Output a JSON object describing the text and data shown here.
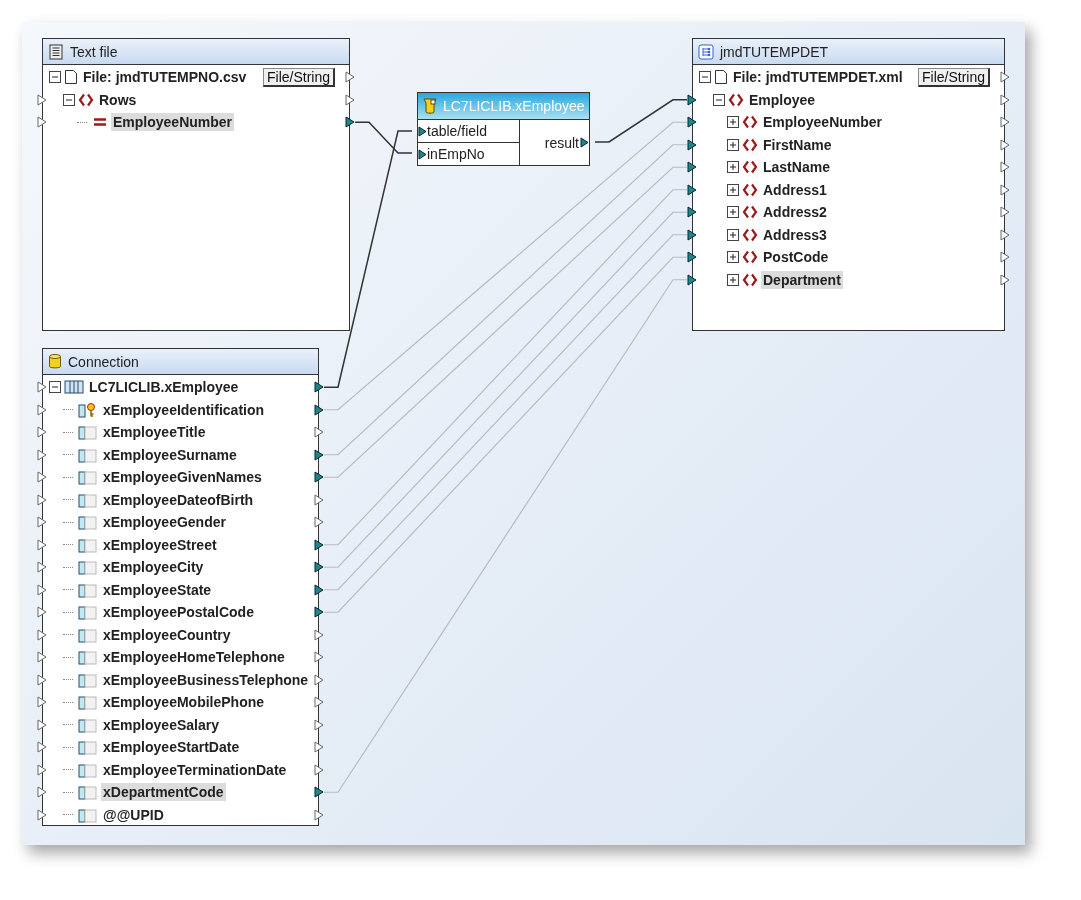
{
  "text_file": {
    "title": "Text file",
    "tree": [
      {
        "kind": "file",
        "label": "File: jmdTUTEMPNO.csv",
        "button": "File/String",
        "expanded": true,
        "selected": false,
        "out_connected": false,
        "children": [
          {
            "kind": "element",
            "label": "Rows",
            "expanded": true,
            "selected": false,
            "in_connected": false,
            "out_connected": false,
            "children": [
              {
                "kind": "field",
                "label": "EmployeeNumber",
                "selected": true,
                "in_connected": false,
                "out_connected": true
              }
            ]
          }
        ]
      }
    ]
  },
  "function": {
    "title": "LC7LICLIB.xEmployee",
    "inputs": [
      {
        "label": "table/field",
        "connected": true
      },
      {
        "label": "inEmpNo",
        "connected": true
      }
    ],
    "output": {
      "label": "result",
      "connected": true
    }
  },
  "target": {
    "title": "jmdTUTEMPDET",
    "tree": [
      {
        "kind": "file",
        "label": "File: jmdTUTEMPDET.xml",
        "button": "File/String",
        "expanded": true,
        "selected": false,
        "out_connected": false,
        "children": [
          {
            "kind": "element",
            "label": "Employee",
            "expanded": true,
            "selected": false,
            "in_connected": true,
            "out_connected": false,
            "children": [
              {
                "kind": "element",
                "label": "EmployeeNumber",
                "expanded": false,
                "selected": false,
                "in_connected": true,
                "out_connected": false
              },
              {
                "kind": "element",
                "label": "FirstName",
                "expanded": false,
                "selected": false,
                "in_connected": true,
                "out_connected": false
              },
              {
                "kind": "element",
                "label": "LastName",
                "expanded": false,
                "selected": false,
                "in_connected": true,
                "out_connected": false
              },
              {
                "kind": "element",
                "label": "Address1",
                "expanded": false,
                "selected": false,
                "in_connected": true,
                "out_connected": false
              },
              {
                "kind": "element",
                "label": "Address2",
                "expanded": false,
                "selected": false,
                "in_connected": true,
                "out_connected": false
              },
              {
                "kind": "element",
                "label": "Address3",
                "expanded": false,
                "selected": false,
                "in_connected": true,
                "out_connected": false
              },
              {
                "kind": "element",
                "label": "PostCode",
                "expanded": false,
                "selected": false,
                "in_connected": true,
                "out_connected": false
              },
              {
                "kind": "element",
                "label": "Department",
                "expanded": false,
                "selected": true,
                "in_connected": true,
                "out_connected": false
              }
            ]
          }
        ]
      }
    ]
  },
  "connection": {
    "title": "Connection",
    "tree": [
      {
        "kind": "table",
        "label": "LC7LICLIB.xEmployee",
        "expanded": true,
        "selected": false,
        "in_connected": false,
        "out_connected": true,
        "children": [
          {
            "kind": "key_column",
            "label": "xEmployeeIdentification",
            "selected": false,
            "in_connected": false,
            "out_connected": true
          },
          {
            "kind": "column",
            "label": "xEmployeeTitle",
            "selected": false,
            "in_connected": false,
            "out_connected": false
          },
          {
            "kind": "column",
            "label": "xEmployeeSurname",
            "selected": false,
            "in_connected": false,
            "out_connected": true
          },
          {
            "kind": "column",
            "label": "xEmployeeGivenNames",
            "selected": false,
            "in_connected": false,
            "out_connected": true
          },
          {
            "kind": "column",
            "label": "xEmployeeDateofBirth",
            "selected": false,
            "in_connected": false,
            "out_connected": false
          },
          {
            "kind": "column",
            "label": "xEmployeeGender",
            "selected": false,
            "in_connected": false,
            "out_connected": false
          },
          {
            "kind": "column",
            "label": "xEmployeeStreet",
            "selected": false,
            "in_connected": false,
            "out_connected": true
          },
          {
            "kind": "column",
            "label": "xEmployeeCity",
            "selected": false,
            "in_connected": false,
            "out_connected": true
          },
          {
            "kind": "column",
            "label": "xEmployeeState",
            "selected": false,
            "in_connected": false,
            "out_connected": true
          },
          {
            "kind": "column",
            "label": "xEmployeePostalCode",
            "selected": false,
            "in_connected": false,
            "out_connected": true
          },
          {
            "kind": "column",
            "label": "xEmployeeCountry",
            "selected": false,
            "in_connected": false,
            "out_connected": false
          },
          {
            "kind": "column",
            "label": "xEmployeeHomeTelephone",
            "selected": false,
            "in_connected": false,
            "out_connected": false
          },
          {
            "kind": "column",
            "label": "xEmployeeBusinessTelephone",
            "selected": false,
            "in_connected": false,
            "out_connected": false
          },
          {
            "kind": "column",
            "label": "xEmployeeMobilePhone",
            "selected": false,
            "in_connected": false,
            "out_connected": false
          },
          {
            "kind": "column",
            "label": "xEmployeeSalary",
            "selected": false,
            "in_connected": false,
            "out_connected": false
          },
          {
            "kind": "column",
            "label": "xEmployeeStartDate",
            "selected": false,
            "in_connected": false,
            "out_connected": false
          },
          {
            "kind": "column",
            "label": "xEmployeeTerminationDate",
            "selected": false,
            "in_connected": false,
            "out_connected": false
          },
          {
            "kind": "column",
            "label": "xDepartmentCode",
            "selected": true,
            "in_connected": false,
            "out_connected": true
          },
          {
            "kind": "column",
            "label": "@@UPID",
            "selected": false,
            "in_connected": false,
            "out_connected": false
          }
        ]
      }
    ]
  }
}
